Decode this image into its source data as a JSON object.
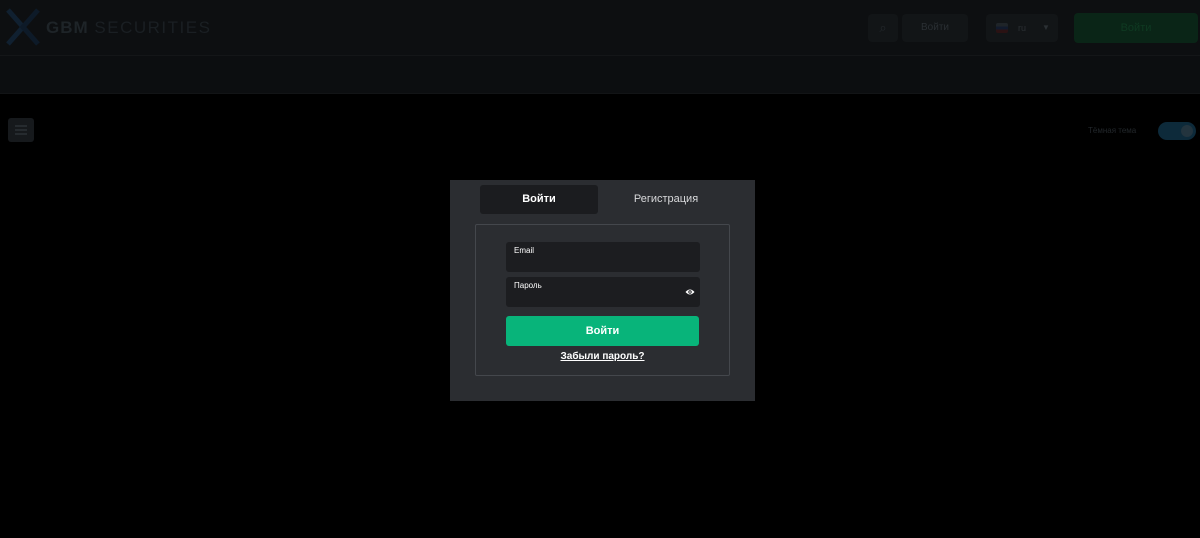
{
  "header": {
    "logo_bold": "GBM",
    "logo_thin": "SECURITIES",
    "search_icon": "search-icon",
    "login_label": "Войти",
    "language": {
      "code": "ru",
      "flag": "russia-flag-icon"
    },
    "register_label": "Войти"
  },
  "subbar": {
    "menu_icon": "hamburger-menu-icon",
    "theme_label": "Тёмная тема",
    "theme_dark": true
  },
  "modal": {
    "tabs": [
      {
        "label": "Войти",
        "active": true
      },
      {
        "label": "Регистрация",
        "active": false
      }
    ],
    "form": {
      "email_label": "Email",
      "email_value": "",
      "password_label": "Пароль",
      "password_value": "",
      "show_password_icon": "eye-icon",
      "submit_label": "Войти",
      "forgot_label": "Забыли пароль?"
    }
  },
  "colors": {
    "accent": "#08b47a",
    "modal_bg": "#2b2d31",
    "field_bg": "#1c1d20",
    "active_tab_bg": "#1b1c1f"
  }
}
